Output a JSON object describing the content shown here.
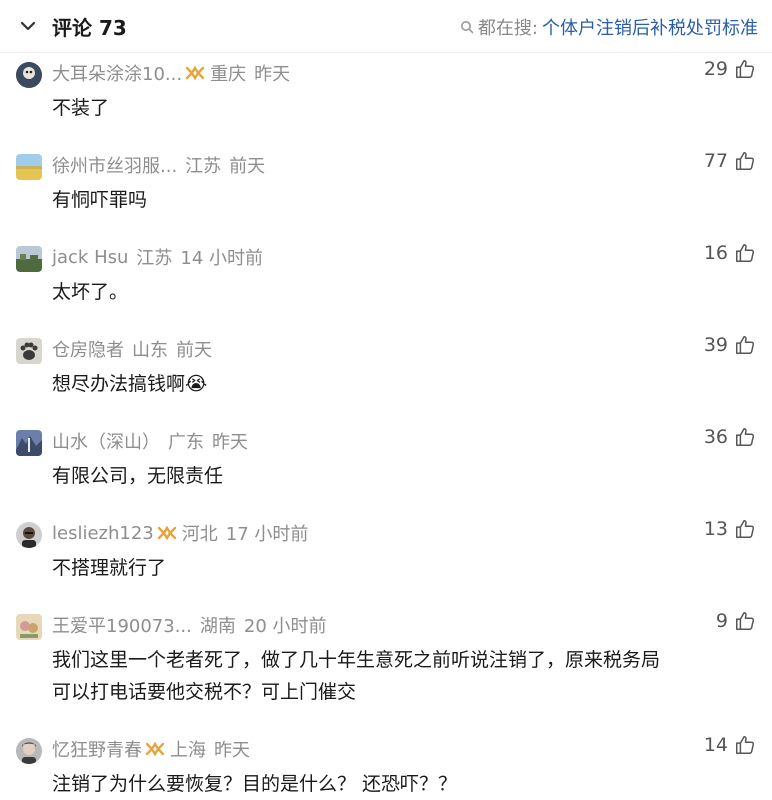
{
  "header": {
    "title": "评论 73",
    "search_prefix": "都在搜:",
    "search_query": "个体户注销后补税处罚标准"
  },
  "comments": [
    {
      "name": "大耳朵涂涂10...",
      "badge": true,
      "location": "重庆",
      "time": "昨天",
      "text": "不装了",
      "likes": "29"
    },
    {
      "name": "徐州市丝羽服...",
      "badge": false,
      "location": "江苏",
      "time": "前天",
      "text": "有恫吓罪吗",
      "likes": "77"
    },
    {
      "name": "jack Hsu",
      "badge": false,
      "location": "江苏",
      "time": "14 小时前",
      "text": "太坏了。",
      "likes": "16"
    },
    {
      "name": "仓房隐者",
      "badge": false,
      "location": "山东",
      "time": "前天",
      "text": "想尽办法搞钱啊",
      "emoji": "😭",
      "likes": "39"
    },
    {
      "name": "山水（深山）",
      "badge": false,
      "location": "广东",
      "time": "昨天",
      "text": "有限公司，无限责任",
      "likes": "36"
    },
    {
      "name": "lesliezh123",
      "badge": true,
      "location": "河北",
      "time": "17 小时前",
      "text": "不搭理就行了",
      "likes": "13"
    },
    {
      "name": "王爱平190073...",
      "badge": false,
      "location": "湖南",
      "time": "20 小时前",
      "text_line1": "我们这里一个老者死了，做了几十年生意死之前听说注销了，原来税务局",
      "text_line2": "可以打电话要他交税不？可上门催交",
      "likes": "9"
    },
    {
      "name": "忆狂野青春",
      "badge": true,
      "location": "上海",
      "time": "昨天",
      "text": "注销了为什么要恢复？目的是什么？ 还恐吓？？",
      "likes": "14"
    }
  ],
  "icons": {
    "header": [
      "chevron-down-icon",
      "search-icon"
    ],
    "comment": [
      "avatar",
      "vip-badge-icon",
      "thumbs-up-icon"
    ]
  },
  "colors": {
    "link": "#2b5ea8",
    "meta": "#8e8e8e",
    "badge": "#e8a33d"
  }
}
